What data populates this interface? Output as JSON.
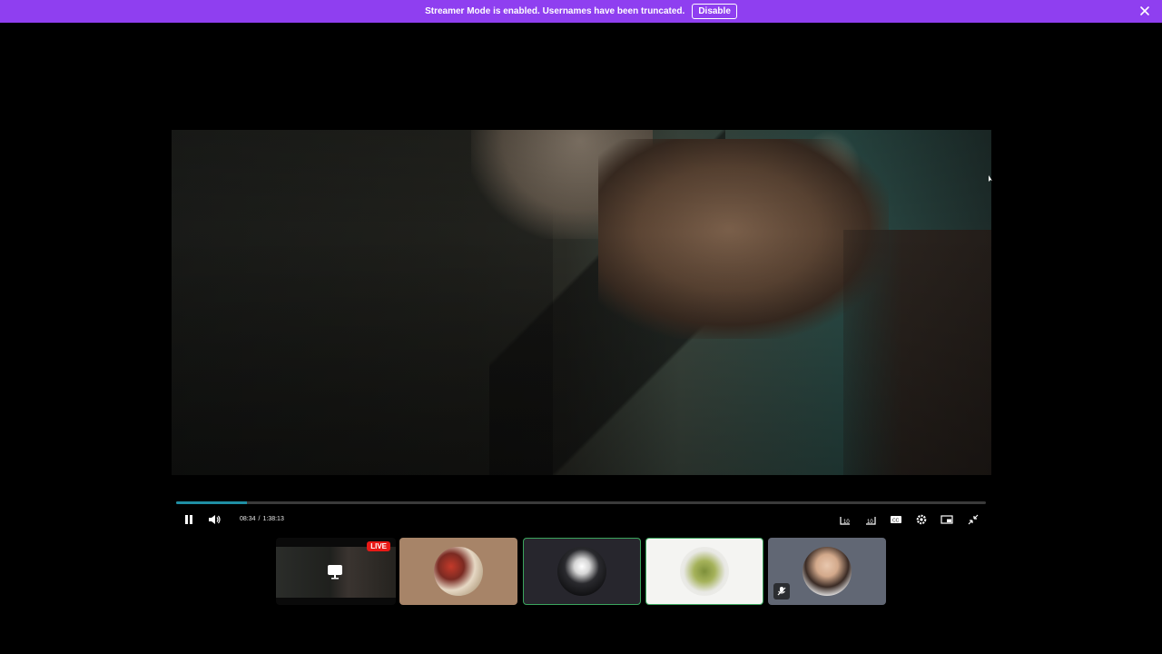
{
  "banner": {
    "message": "Streamer Mode is enabled. Usernames have been truncated.",
    "disable_label": "Disable",
    "close_icon": "close-icon",
    "color": "#8f3ff0"
  },
  "player": {
    "progress_fraction": 0.088,
    "progress_color": "#1f8fa4",
    "current_time": "08:34",
    "separator": "/",
    "duration": "1:38:13",
    "controls_left": [
      "pause-icon",
      "volume-icon"
    ],
    "controls_right": [
      "rewind-10-icon",
      "forward-10-icon",
      "captions-icon",
      "gear-icon",
      "picture-in-picture-icon",
      "collapse-icon"
    ]
  },
  "participants": [
    {
      "kind": "screen-share",
      "live_label": "LIVE"
    },
    {
      "kind": "avatar",
      "speaking": false
    },
    {
      "kind": "avatar",
      "speaking": true
    },
    {
      "kind": "avatar",
      "speaking": true
    },
    {
      "kind": "avatar",
      "muted": true
    }
  ]
}
